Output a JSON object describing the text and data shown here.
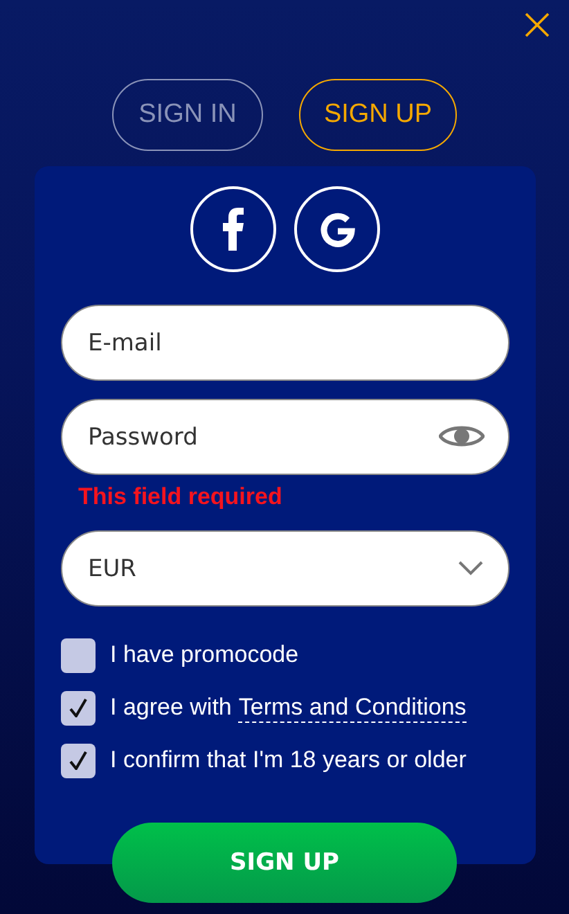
{
  "tabs": [
    {
      "label": "SIGN IN",
      "selected": false
    },
    {
      "label": "SIGN UP",
      "selected": true
    }
  ],
  "fields": [
    {
      "placeholder": "E-mail",
      "kind": "text"
    },
    {
      "placeholder": "Password",
      "kind": "password",
      "error": "This field required"
    },
    {
      "value": "EUR",
      "kind": "select"
    }
  ],
  "checkboxes": [
    {
      "label": "I have promocode",
      "checked": false
    },
    {
      "label": "I agree with",
      "link": "Terms and Conditions",
      "checked": true
    },
    {
      "label": "I confirm that I'm 18 years or older",
      "checked": true
    }
  ],
  "submit": "SIGN UP"
}
